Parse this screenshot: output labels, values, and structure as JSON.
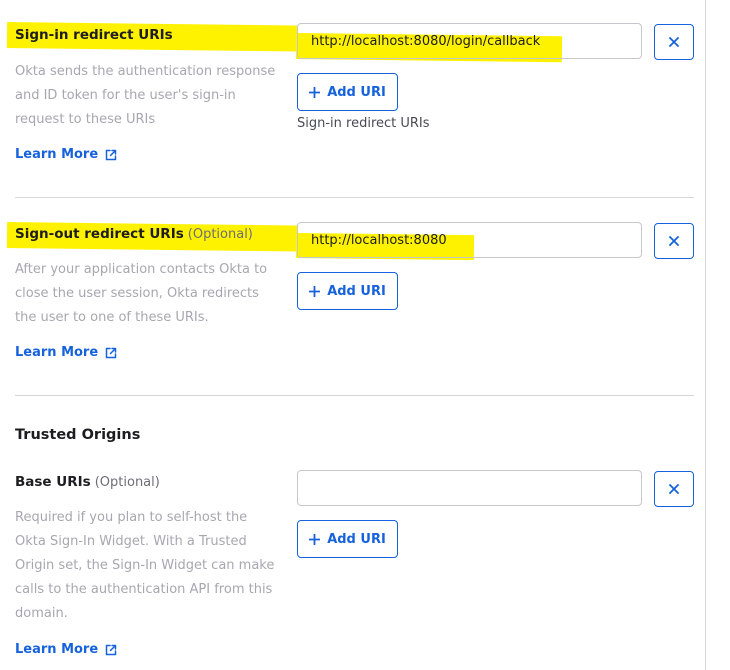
{
  "sign_in": {
    "label": "Sign-in redirect URIs",
    "description": "Okta sends the authentication response and ID token for the user's sign-in request to these URIs",
    "learn_more": "Learn More",
    "uri_value": "http://localhost:8080/login/callback",
    "add_label": "Add URI",
    "helper": "Sign-in redirect URIs"
  },
  "sign_out": {
    "label": "Sign-out redirect URIs",
    "optional": "(Optional)",
    "description": "After your application contacts Okta to close the user session, Okta redirects the user to one of these URIs.",
    "learn_more": "Learn More",
    "uri_value": "http://localhost:8080",
    "add_label": "Add URI"
  },
  "trusted_origins": {
    "title": "Trusted Origins",
    "label": "Base URIs",
    "optional": "(Optional)",
    "description": "Required if you plan to self-host the Okta Sign-In Widget. With a Trusted Origin set, the Sign-In Widget can make calls to the authentication API from this domain.",
    "learn_more": "Learn More",
    "uri_value": "",
    "add_label": "Add URI"
  },
  "colors": {
    "accent": "#1662dd",
    "highlight": "#fff200",
    "muted_text": "#a7a7b0"
  },
  "icons": [
    "close-icon",
    "plus-icon",
    "external-link-icon"
  ]
}
